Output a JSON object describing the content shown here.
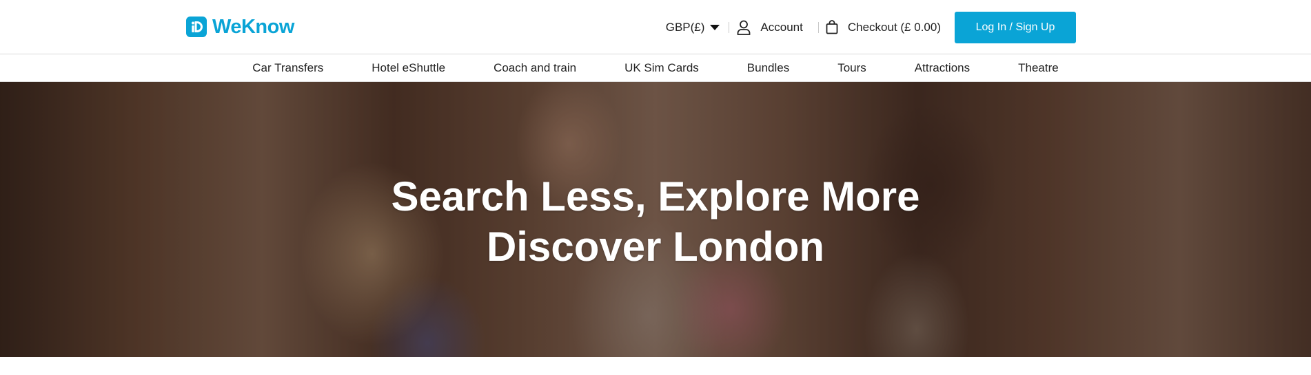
{
  "brand": {
    "name": "WeKnow",
    "color": "#0aa4d6",
    "icon": "info-logo-icon"
  },
  "header": {
    "currency": "GBP(£)",
    "account_label": "Account",
    "checkout_label": "Checkout (£ 0.00)",
    "login_label": "Log In / Sign Up"
  },
  "nav": {
    "items": [
      {
        "label": "Car Transfers"
      },
      {
        "label": "Hotel eShuttle"
      },
      {
        "label": "Coach and train"
      },
      {
        "label": "UK Sim Cards"
      },
      {
        "label": "Bundles"
      },
      {
        "label": "Tours"
      },
      {
        "label": "Attractions"
      },
      {
        "label": "Theatre"
      }
    ]
  },
  "hero": {
    "line1": "Search Less, Explore More",
    "line2": "Discover London"
  }
}
